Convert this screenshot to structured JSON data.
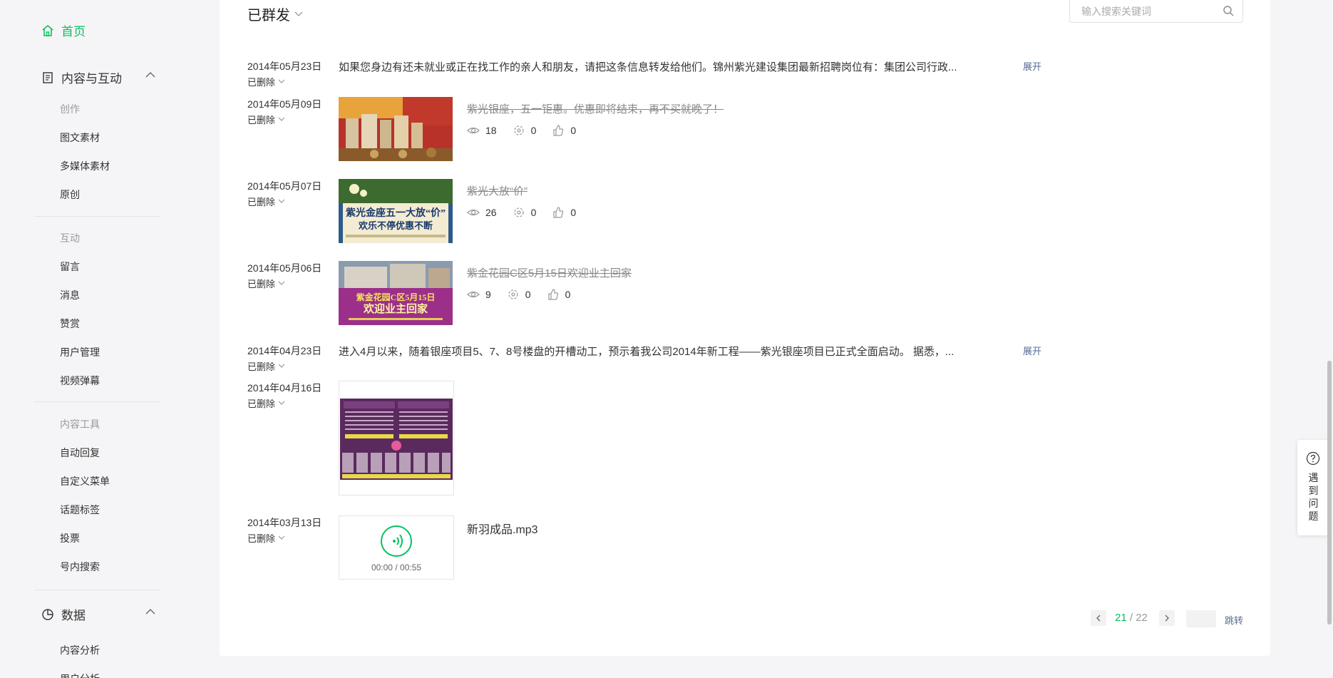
{
  "sidebar": {
    "home": "首页",
    "content_section": "内容与互动",
    "create_group": "创作",
    "create_items": [
      "图文素材",
      "多媒体素材",
      "原创"
    ],
    "interact_group": "互动",
    "interact_items": [
      "留言",
      "消息",
      "赞赏",
      "用户管理",
      "视频弹幕"
    ],
    "tools_group": "内容工具",
    "tools_items": [
      "自动回复",
      "自定义菜单",
      "话题标签",
      "投票",
      "号内搜索"
    ],
    "data_section": "数据",
    "data_items": [
      "内容分析",
      "用户分析"
    ]
  },
  "header": {
    "title": "已群发",
    "search_placeholder": "输入搜索关键词"
  },
  "rows": [
    {
      "date": "2014年05月23日",
      "status": "已删除",
      "text": "如果您身边有还未就业或正在找工作的亲人和朋友，请把这条信息转发给他们。锦州紫光建设集团最新招聘岗位有：集团公司行政...",
      "expand": "展开"
    },
    {
      "date": "2014年05月09日",
      "status": "已删除",
      "title": "紫光银座，五一钜惠。优惠即将结束，再不买就晚了！",
      "reads": "18",
      "shares": "0",
      "likes": "0"
    },
    {
      "date": "2014年05月07日",
      "status": "已删除",
      "title": "紫光大放“价”",
      "reads": "26",
      "shares": "0",
      "likes": "0",
      "thumb_text_1": "紫光金座五一大放“价”",
      "thumb_text_2": "欢乐不停优惠不断"
    },
    {
      "date": "2014年05月06日",
      "status": "已删除",
      "title": "紫金花园C区5月15日欢迎业主回家",
      "reads": "9",
      "shares": "0",
      "likes": "0",
      "thumb_text_1": "紫金花园C区5月15日",
      "thumb_text_2": "欢迎业主回家"
    },
    {
      "date": "2014年04月23日",
      "status": "已删除",
      "text": "进入4月以来，随着银座项目5、7、8号楼盘的开槽动工，预示着我公司2014年新工程——紫光银座项目已正式全面启动。 据悉，...",
      "expand": "展开"
    },
    {
      "date": "2014年04月16日",
      "status": "已删除"
    },
    {
      "date": "2014年03月13日",
      "status": "已删除",
      "audio_name": "新羽成品.mp3",
      "audio_current": "00:00",
      "audio_sep": "/",
      "audio_total": "00:55"
    }
  ],
  "pagination": {
    "current": "21",
    "sep": "/",
    "total": "22",
    "jump": "跳转"
  },
  "help": {
    "text": "遇到问题"
  },
  "colors": {
    "accent": "#07c160",
    "link": "#576b95"
  }
}
